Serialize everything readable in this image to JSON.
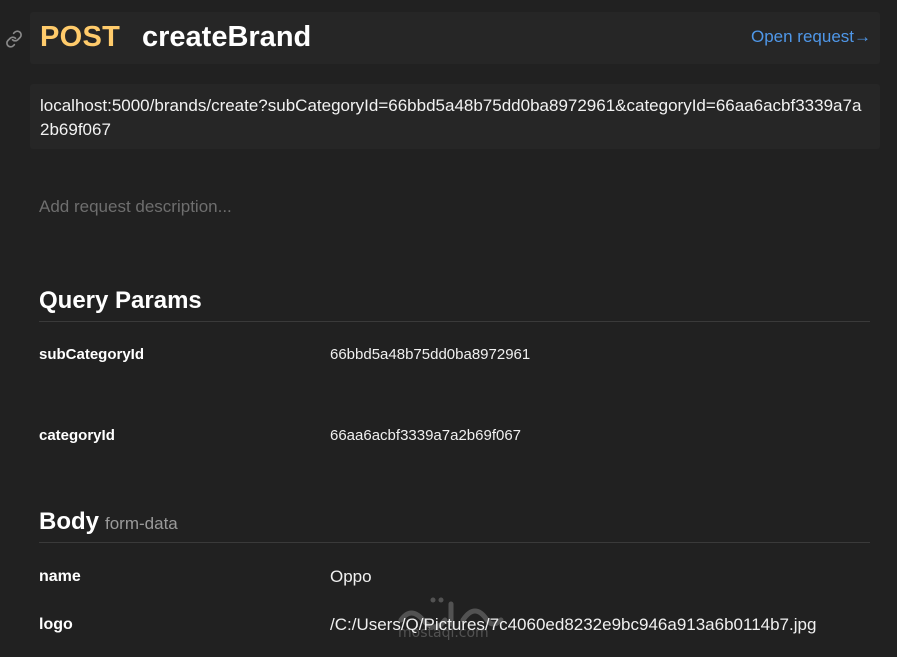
{
  "request": {
    "method": "POST",
    "name": "createBrand",
    "open_label": "Open request→",
    "url": "localhost:5000/brands/create?subCategoryId=66bbd5a48b75dd0ba8972961&categoryId=66aa6acbf3339a7a2b69f067",
    "description_placeholder": "Add request description..."
  },
  "query_params": {
    "title": "Query Params",
    "rows": [
      {
        "key": "subCategoryId",
        "value": "66bbd5a48b75dd0ba8972961"
      },
      {
        "key": "categoryId",
        "value": "66aa6acbf3339a7a2b69f067"
      }
    ]
  },
  "body": {
    "title": "Body",
    "type": "form-data",
    "rows": [
      {
        "key": "name",
        "value": "Oppo"
      },
      {
        "key": "logo",
        "value": "/C:/Users/Q/Pictures/7c4060ed8232e9bc946a913a6b0114b7.jpg"
      }
    ]
  },
  "watermark": {
    "text": "mostaql.com"
  },
  "icons": {
    "link": "link-icon"
  },
  "colors": {
    "background": "#212121",
    "method": "#ffcb6b",
    "link": "#4f97e8",
    "placeholder": "#6e6e6e"
  }
}
